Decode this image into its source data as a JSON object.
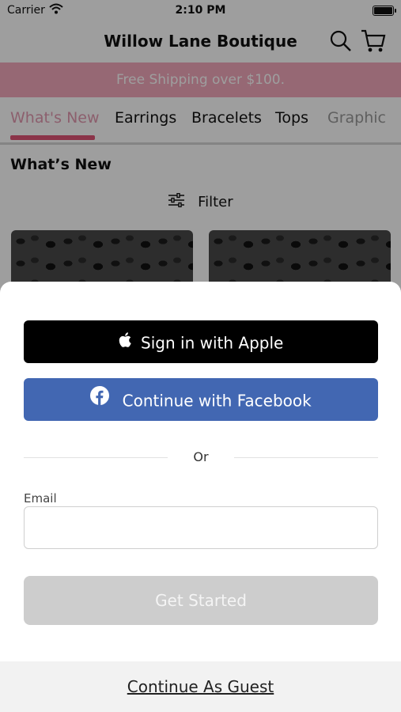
{
  "status_bar": {
    "carrier": "Carrier",
    "time": "2:10 PM"
  },
  "nav": {
    "title": "Willow Lane Boutique",
    "search_icon": "search-icon",
    "cart_icon": "cart-icon"
  },
  "promo": {
    "text": "Free Shipping over $100."
  },
  "tabs": [
    {
      "label": "What's New",
      "active": true
    },
    {
      "label": "Earrings"
    },
    {
      "label": "Bracelets"
    },
    {
      "label": "Tops"
    },
    {
      "label": "Graphic"
    }
  ],
  "section": {
    "title": "What’s New"
  },
  "filter": {
    "label": "Filter",
    "icon": "sliders-icon"
  },
  "sheet": {
    "apple_button": "Sign in with Apple",
    "facebook_button": "Continue with Facebook",
    "or_text": "Or",
    "email_label": "Email",
    "email_value": "",
    "email_placeholder": "",
    "get_started": "Get Started",
    "guest_link": "Continue As Guest"
  },
  "colors": {
    "promo_bg": "#f2a9bc",
    "facebook_blue": "#4267b2",
    "apple_black": "#000000",
    "disabled_button": "#cdcdcd",
    "tab_accent": "#e05577"
  }
}
